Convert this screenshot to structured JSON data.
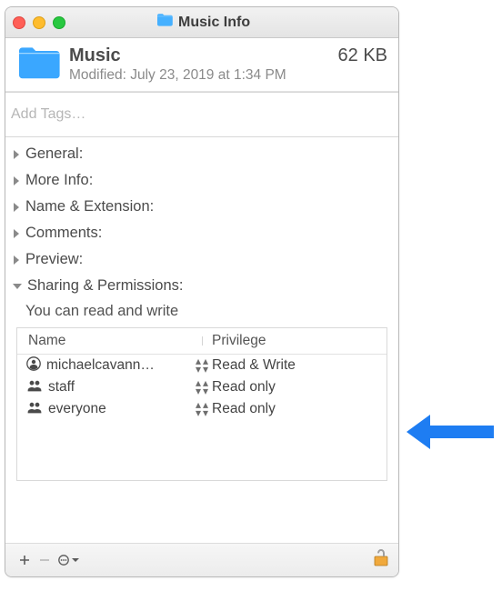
{
  "titlebar": {
    "title": "Music Info"
  },
  "header": {
    "name": "Music",
    "size": "62 KB",
    "modified_label": "Modified:",
    "modified_value": "July 23, 2019 at 1:34 PM"
  },
  "tags": {
    "placeholder": "Add Tags…"
  },
  "sections": {
    "general": "General:",
    "more_info": "More Info:",
    "name_ext": "Name & Extension:",
    "comments": "Comments:",
    "preview": "Preview:",
    "sharing": "Sharing & Permissions:"
  },
  "permissions": {
    "summary": "You can read and write",
    "columns": {
      "name": "Name",
      "privilege": "Privilege"
    },
    "rows": [
      {
        "icon": "user",
        "name": "michaelcavann…",
        "privilege": "Read & Write"
      },
      {
        "icon": "group",
        "name": "staff",
        "privilege": "Read only"
      },
      {
        "icon": "group",
        "name": "everyone",
        "privilege": "Read only"
      }
    ]
  }
}
